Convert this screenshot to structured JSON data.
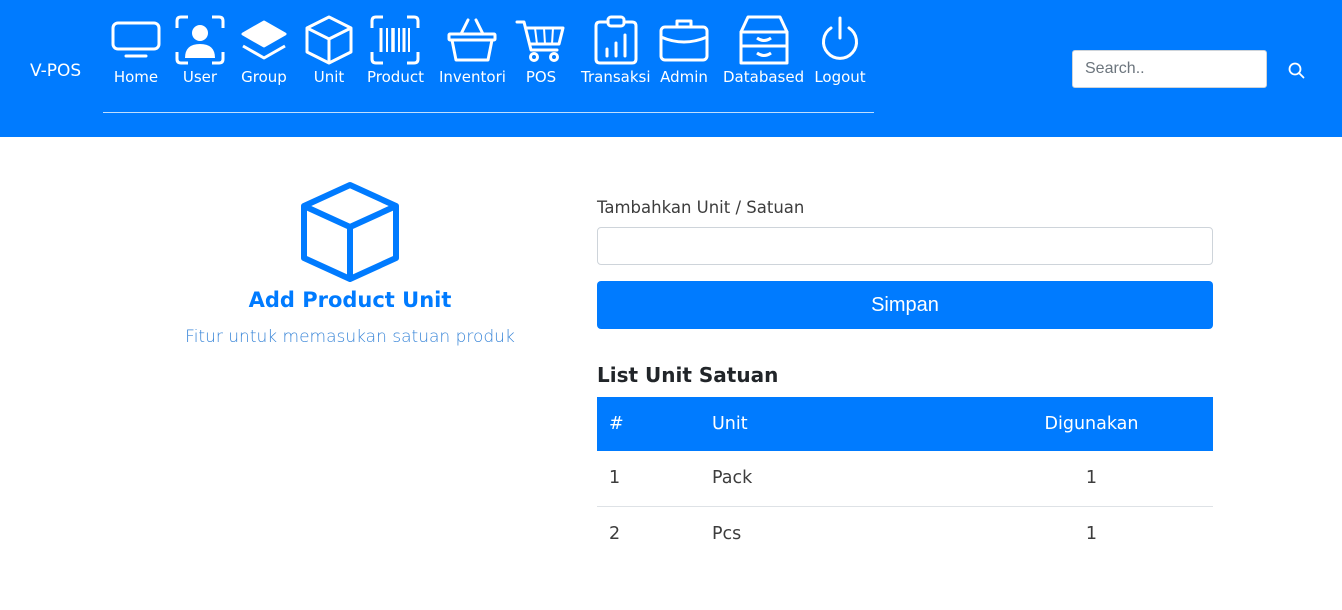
{
  "navbar": {
    "brand": "V-POS",
    "items": [
      {
        "label": "Home",
        "icon": "monitor-icon"
      },
      {
        "label": "User",
        "icon": "user-icon"
      },
      {
        "label": "Group",
        "icon": "layers-icon"
      },
      {
        "label": "Unit",
        "icon": "box-icon"
      },
      {
        "label": "Product",
        "icon": "barcode-icon"
      },
      {
        "label": "Inventori",
        "icon": "basket-icon"
      },
      {
        "label": "POS",
        "icon": "cart-icon"
      },
      {
        "label": "Transaksi",
        "icon": "clipboard-chart-icon"
      },
      {
        "label": "Admin",
        "icon": "briefcase-icon"
      },
      {
        "label": "Databased",
        "icon": "archive-icon"
      },
      {
        "label": "Logout",
        "icon": "power-icon"
      }
    ],
    "search": {
      "placeholder": "Search..",
      "value": "",
      "icon": "search-icon"
    }
  },
  "intro": {
    "icon": "box-icon",
    "title": "Add Product Unit",
    "description": "Fitur untuk memasukan satuan produk"
  },
  "form": {
    "label": "Tambahkan Unit / Satuan",
    "input_value": "",
    "input_placeholder": "",
    "save_label": "Simpan"
  },
  "list": {
    "title": "List Unit Satuan",
    "columns": [
      "#",
      "Unit",
      "Digunakan"
    ],
    "rows": [
      {
        "no": "1",
        "unit": "Pack",
        "used": "1"
      },
      {
        "no": "2",
        "unit": "Pcs",
        "used": "1"
      }
    ]
  },
  "colors": {
    "primary": "#007bff",
    "link": "#3a86d8",
    "text": "#212529"
  }
}
